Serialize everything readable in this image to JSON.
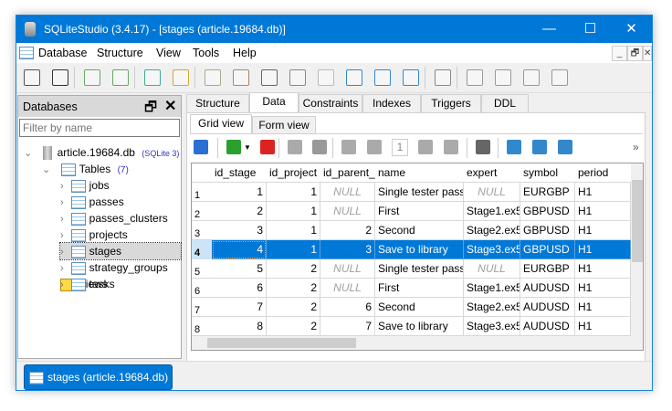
{
  "window": {
    "title": "SQLiteStudio (3.4.17) - [stages (article.19684.db)]",
    "controls": {
      "minimize": "—",
      "maximize": "☐",
      "close": "✕"
    }
  },
  "menu": {
    "items": [
      "Database",
      "Structure",
      "View",
      "Tools",
      "Help"
    ],
    "mdi": [
      "_",
      "🗗",
      "✕"
    ]
  },
  "toolbar": {
    "icons": [
      "connect-icon",
      "disconnect-icon",
      "add-database-icon",
      "refresh-database-icon",
      "create-table-icon",
      "edit-table-icon",
      "sql-editor-icon",
      "ddl-history-icon",
      "functions-icon",
      "collations-icon",
      "extensions-icon",
      "import-icon",
      "export-icon",
      "expand-icon",
      "config-icon",
      "tile-icon",
      "tile-vertical-icon",
      "tile-horizontal-icon",
      "cascade-icon"
    ]
  },
  "databases": {
    "title": "Databases",
    "filter_placeholder": "Filter by name",
    "db_name": "article.19684.db",
    "db_type": "(SQLite 3)",
    "tables_label": "Tables",
    "tables_count": "(7)",
    "tables": [
      "jobs",
      "passes",
      "passes_clusters",
      "projects",
      "stages",
      "strategy_groups",
      "tasks"
    ],
    "selected_table": "stages",
    "views_label": "Views"
  },
  "tabs": [
    "Structure",
    "Data",
    "Constraints",
    "Indexes",
    "Triggers",
    "DDL"
  ],
  "active_tab": "Data",
  "subtabs": [
    "Grid view",
    "Form view"
  ],
  "active_subtab": "Grid view",
  "grid_toolbar": {
    "page": "1",
    "more": "»"
  },
  "grid": {
    "columns": [
      "id_stage",
      "id_project",
      "id_parent_",
      "name",
      "expert",
      "symbol",
      "period"
    ],
    "rows": [
      [
        "1",
        "1",
        "NULL",
        "Single tester pass",
        "NULL",
        "EURGBP",
        "H1"
      ],
      [
        "2",
        "1",
        "NULL",
        "First",
        "Stage1.ex5",
        "GBPUSD",
        "H1"
      ],
      [
        "3",
        "1",
        "2",
        "Second",
        "Stage2.ex5",
        "GBPUSD",
        "H1"
      ],
      [
        "4",
        "1",
        "3",
        "Save to library",
        "Stage3.ex5",
        "GBPUSD",
        "H1"
      ],
      [
        "5",
        "2",
        "NULL",
        "Single tester pass",
        "NULL",
        "EURGBP",
        "H1"
      ],
      [
        "6",
        "2",
        "NULL",
        "First",
        "Stage1.ex5",
        "AUDUSD",
        "H1"
      ],
      [
        "7",
        "2",
        "6",
        "Second",
        "Stage2.ex5",
        "AUDUSD",
        "H1"
      ],
      [
        "8",
        "2",
        "7",
        "Save to library",
        "Stage3.ex5",
        "AUDUSD",
        "H1"
      ]
    ],
    "selected_row": 4
  },
  "dock": {
    "window_label": "stages (article.19684.db)"
  },
  "colors": {
    "accent": "#0078d7",
    "null_text": "#a0a0a0"
  }
}
